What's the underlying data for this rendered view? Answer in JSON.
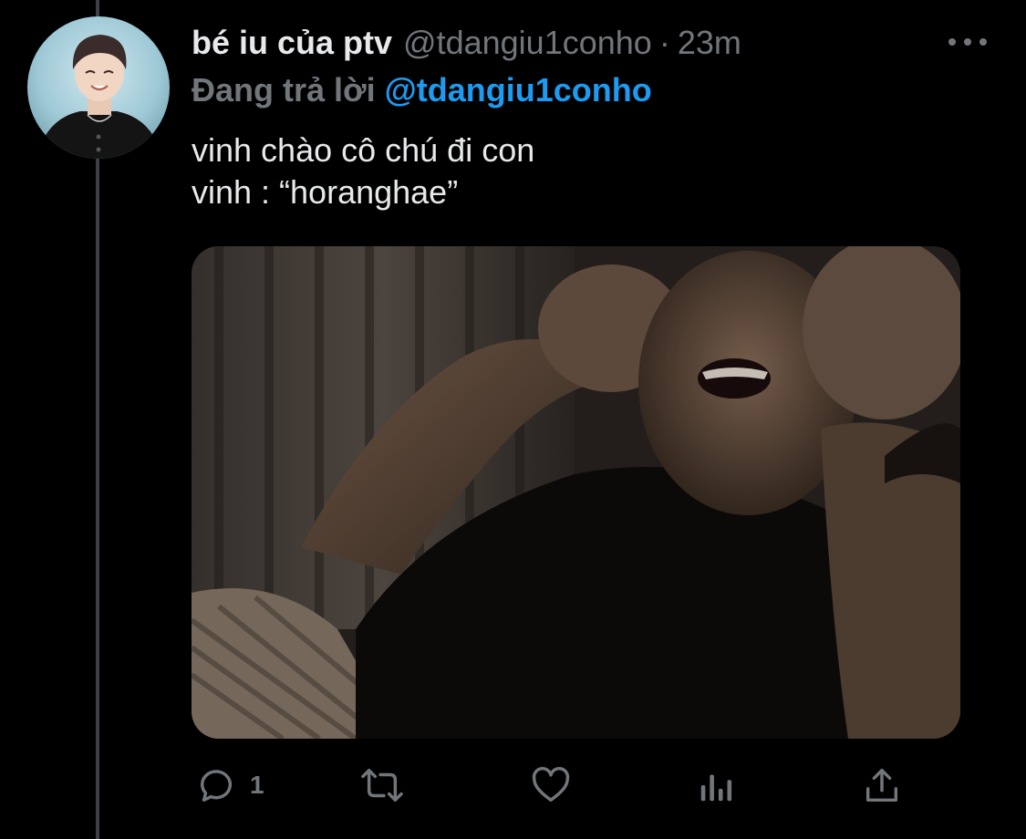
{
  "tweet": {
    "display_name": "bé iu của ptv",
    "handle": "@tdangiu1conho",
    "separator": "·",
    "time": "23m",
    "reply_prefix": "Đang trả lời",
    "reply_mention": "@tdangiu1conho",
    "text_lines": [
      "vinh chào cô chú đi con",
      "vinh : “horanghae”"
    ]
  },
  "actions": {
    "reply_count": "1",
    "icons": [
      "reply-icon",
      "retweet-icon",
      "like-icon",
      "analytics-icon",
      "share-icon"
    ]
  },
  "colors": {
    "background": "#000000",
    "text_primary": "#e7e9ea",
    "text_secondary": "#71767b",
    "accent": "#1d9bf0"
  }
}
